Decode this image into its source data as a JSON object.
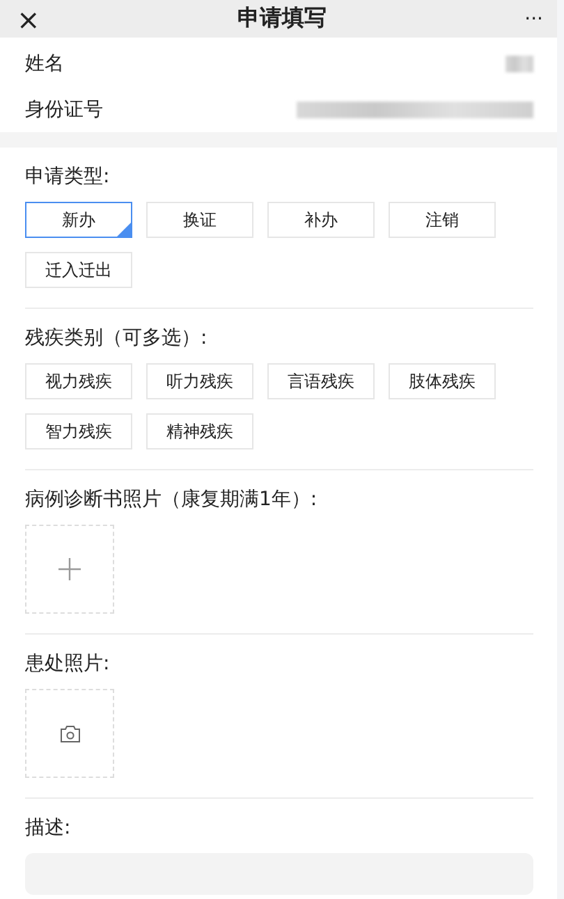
{
  "header": {
    "close": "×",
    "title": "申请填写",
    "more": "···"
  },
  "info": [
    {
      "label": "姓名"
    },
    {
      "label": "身份证号"
    }
  ],
  "apply_type": {
    "label": "申请类型:",
    "options": [
      {
        "label": "新办",
        "selected": true
      },
      {
        "label": "换证",
        "selected": false
      },
      {
        "label": "补办",
        "selected": false
      },
      {
        "label": "注销",
        "selected": false
      },
      {
        "label": "迁入迁出",
        "selected": false
      }
    ]
  },
  "disability": {
    "label": "残疾类别（可多选）:",
    "options": [
      {
        "label": "视力残疾",
        "selected": false
      },
      {
        "label": "听力残疾",
        "selected": false
      },
      {
        "label": "言语残疾",
        "selected": false
      },
      {
        "label": "肢体残疾",
        "selected": false
      },
      {
        "label": "智力残疾",
        "selected": false
      },
      {
        "label": "精神残疾",
        "selected": false
      }
    ]
  },
  "uploads": [
    {
      "label": "病例诊断书照片（康复期满1年）:",
      "kind": "plus"
    },
    {
      "label": "患处照片:",
      "kind": "camera"
    }
  ],
  "description": {
    "label": "描述:"
  }
}
